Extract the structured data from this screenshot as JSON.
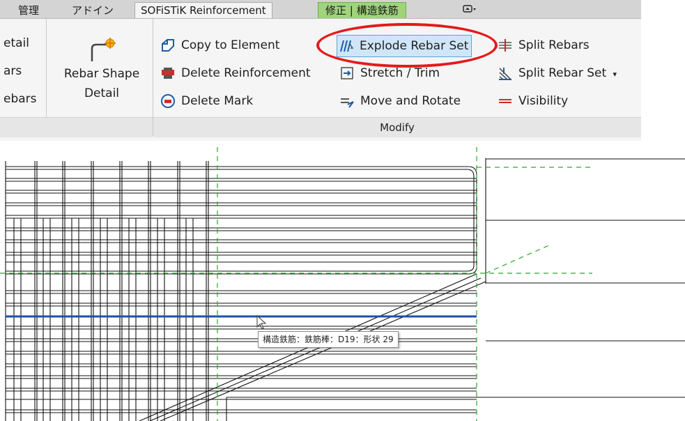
{
  "tabs": {
    "kanri": "管理",
    "addin": "アドイン",
    "sofistik": "SOFiSTiK Reinforcement",
    "modify_rebar": "修正 | 構造鉄筋"
  },
  "left_cut_labels": {
    "detail": "etail",
    "ars": "ars",
    "ebars": "ebars"
  },
  "rebar_shape": {
    "line1": "Rebar Shape",
    "line2": "Detail"
  },
  "modify": {
    "copy_to_element": "Copy to Element",
    "delete_reinforcement": "Delete Reinforcement",
    "delete_mark": "Delete Mark",
    "explode_rebar_set": "Explode Rebar Set",
    "stretch_trim": "Stretch / Trim",
    "move_and_rotate": "Move and Rotate",
    "split_rebars": "Split Rebars",
    "split_rebar_set": "Split Rebar Set",
    "visibility": "Visibility",
    "panel_title": "Modify"
  },
  "tooltip": {
    "text": "構造鉄筋：鉄筋棒：D19：形状 29"
  },
  "colors": {
    "highlight_ring": "#e41a1a",
    "selected_bar": "#1f4fa8",
    "reference_dash": "#2aa82a"
  }
}
